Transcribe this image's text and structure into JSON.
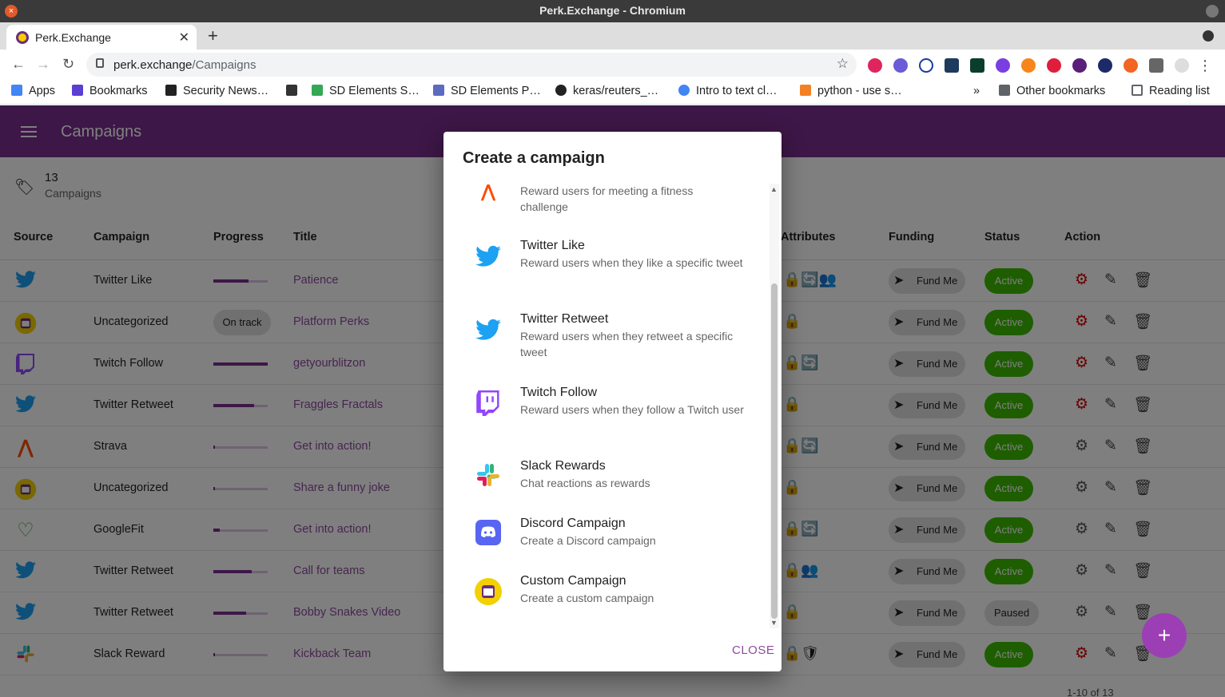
{
  "window": {
    "title": "Perk.Exchange - Chromium"
  },
  "browser": {
    "tab_title": "Perk.Exchange",
    "url_host": "perk.exchange",
    "url_path": "/Campaigns",
    "bookmarks": [
      "Apps",
      "Bookmarks",
      "Security News…",
      "SD Elements S…",
      "SD Elements P…",
      "keras/reuters_…",
      "Intro to text cl…",
      "python - use s…"
    ],
    "overflow": "»",
    "other_bookmarks": "Other bookmarks",
    "reading_list": "Reading list"
  },
  "app": {
    "title": "Campaigns",
    "summary": {
      "count": "13",
      "label": "Campaigns"
    },
    "columns": {
      "source": "Source",
      "campaign": "Campaign",
      "progress": "Progress",
      "title": "Title",
      "attributes": "Attributes",
      "funding": "Funding",
      "status": "Status",
      "action": "Action"
    },
    "rows": [
      {
        "source": "twitter",
        "campaign": "Twitter Like",
        "progress": 0.65,
        "title": "Patience",
        "attrs": "🔒🔄👥",
        "fund": "Fund Me",
        "status": "Active",
        "gear": "red"
      },
      {
        "source": "custom",
        "campaign": "Uncategorized",
        "progress_label": "On track",
        "title": "Platform Perks",
        "attrs": "🔒",
        "fund": "Fund Me",
        "status": "Active",
        "gear": "red"
      },
      {
        "source": "twitch",
        "campaign": "Twitch Follow",
        "progress": 1.0,
        "title": "getyourblitzon",
        "attrs": "🔒🔄",
        "fund": "Fund Me",
        "status": "Active",
        "gear": "red"
      },
      {
        "source": "twitter",
        "campaign": "Twitter Retweet",
        "progress": 0.75,
        "title": "Fraggles Fractals",
        "attrs": "🔒",
        "fund": "Fund Me",
        "status": "Active",
        "gear": "red"
      },
      {
        "source": "strava",
        "campaign": "Strava",
        "progress": 0.03,
        "title": "Get into action!",
        "attrs": "🔒🔄",
        "fund": "Fund Me",
        "status": "Active",
        "gear": "grey"
      },
      {
        "source": "custom",
        "campaign": "Uncategorized",
        "progress": 0.03,
        "title": "Share a funny joke",
        "attrs": "🔒",
        "fund": "Fund Me",
        "status": "Active",
        "gear": "grey"
      },
      {
        "source": "googlefit",
        "campaign": "GoogleFit",
        "progress": 0.12,
        "title": "Get into action!",
        "attrs": "🔒🔄",
        "fund": "Fund Me",
        "status": "Active",
        "gear": "grey"
      },
      {
        "source": "twitter",
        "campaign": "Twitter Retweet",
        "progress": 0.7,
        "title": "Call for teams",
        "attrs": "🔒👥",
        "fund": "Fund Me",
        "status": "Active",
        "gear": "grey"
      },
      {
        "source": "twitter",
        "campaign": "Twitter Retweet",
        "progress": 0.6,
        "title": "Bobby Snakes Video",
        "attrs": "🔒",
        "fund": "Fund Me",
        "status": "Paused",
        "gear": "grey"
      },
      {
        "source": "slack",
        "campaign": "Slack Reward",
        "progress": 0.03,
        "title": "Kickback Team",
        "attrs": "🔒🛡",
        "fund": "Fund Me",
        "status": "Active",
        "gear": "red"
      }
    ],
    "pagination": "1-10 of 13"
  },
  "dialog": {
    "title": "Create a campaign",
    "options": [
      {
        "icon": "strava-icon",
        "title": "",
        "desc": "Reward users for meeting a fitness challenge"
      },
      {
        "icon": "twitter-icon",
        "title": "Twitter Like",
        "desc": "Reward users when they like a specific tweet"
      },
      {
        "icon": "twitter-icon",
        "title": "Twitter Retweet",
        "desc": "Reward users when they retweet a specific tweet"
      },
      {
        "icon": "twitch-icon",
        "title": "Twitch Follow",
        "desc": "Reward users when they follow a Twitch user"
      },
      {
        "icon": "slack-icon",
        "title": "Slack Rewards",
        "desc": "Chat reactions as rewards"
      },
      {
        "icon": "discord-icon",
        "title": "Discord Campaign",
        "desc": "Create a Discord campaign"
      },
      {
        "icon": "custom-campaign-icon",
        "title": "Custom Campaign",
        "desc": "Create a custom campaign"
      }
    ],
    "close": "CLOSE"
  },
  "colors": {
    "brand": "#7b2f8f",
    "active": "#3cbc00",
    "twitter": "#1da1f2",
    "twitch": "#9146ff",
    "discord": "#5865f2"
  }
}
